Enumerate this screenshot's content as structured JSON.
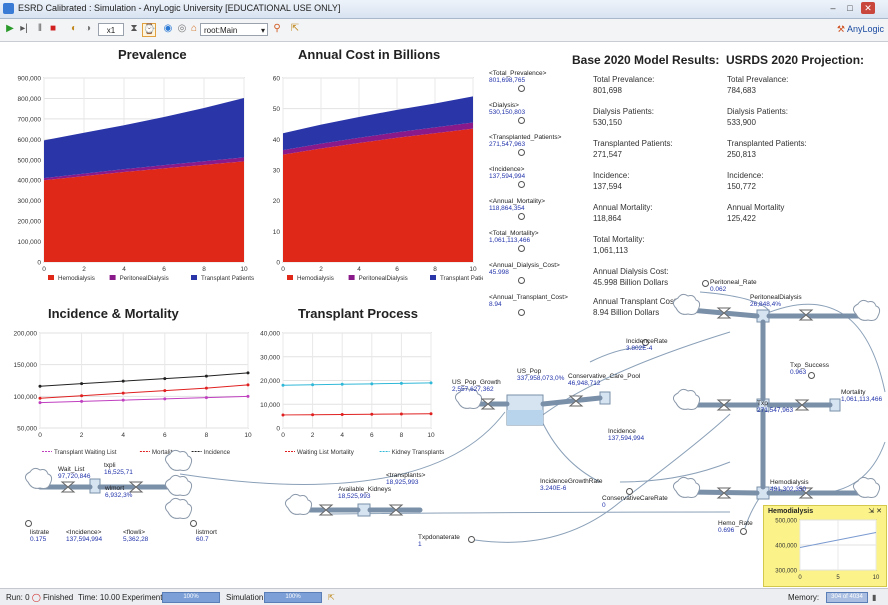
{
  "window": {
    "title": "ESRD Calibrated : Simulation - AnyLogic University  [EDUCATIONAL USE ONLY]",
    "brand": "AnyLogic"
  },
  "toolbar": {
    "speed": "x1",
    "view_select": "root:Main"
  },
  "charts": {
    "prevalence_title": "Prevalence",
    "cost_title": "Annual Cost in Billions",
    "incidence_title": "Incidence & Mortality",
    "transplant_title": "Transplant Process"
  },
  "chart_data": [
    {
      "type": "area",
      "title": "Prevalence",
      "x": [
        0,
        2,
        4,
        6,
        8,
        10
      ],
      "xlim": [
        0,
        10
      ],
      "ylim": [
        0,
        900000
      ],
      "yticks": [
        "900,000",
        "800,000",
        "700,000",
        "600,000",
        "500,000",
        "400,000",
        "300,000",
        "200,000",
        "100,000",
        "0"
      ],
      "stacked": true,
      "series": [
        {
          "name": "Hemodialysis",
          "color": "#e02818",
          "values": [
            400000,
            420000,
            440000,
            458000,
            475000,
            492000
          ]
        },
        {
          "name": "PeritonealDialysis",
          "color": "#8a1a8a",
          "values": [
            10000,
            12000,
            14000,
            16000,
            18000,
            20000
          ]
        },
        {
          "name": "Transplant Patients",
          "color": "#2a35a8",
          "values": [
            185000,
            200000,
            215000,
            235000,
            260000,
            290000
          ]
        }
      ],
      "legend": "bottom"
    },
    {
      "type": "area",
      "title": "Annual Cost in Billions",
      "x": [
        0,
        2,
        4,
        6,
        8,
        10
      ],
      "xlim": [
        0,
        10
      ],
      "ylim": [
        0,
        60
      ],
      "yticks": [
        "60",
        "50",
        "40",
        "30",
        "20",
        "10",
        "0"
      ],
      "stacked": true,
      "series": [
        {
          "name": "Hemodialysis",
          "color": "#e02818",
          "values": [
            35,
            37,
            38.8,
            40.5,
            42,
            43.5
          ]
        },
        {
          "name": "PeritonealDialysis",
          "color": "#8a1a8a",
          "values": [
            1.5,
            1.6,
            1.7,
            1.8,
            1.9,
            2.0
          ]
        },
        {
          "name": "Transplant Patients",
          "color": "#2a35a8",
          "values": [
            5.5,
            6.2,
            6.8,
            7.3,
            7.8,
            8.5
          ]
        }
      ],
      "legend": "bottom"
    },
    {
      "type": "line",
      "title": "Incidence & Mortality",
      "x": [
        0,
        2,
        4,
        6,
        8,
        10
      ],
      "xlim": [
        0,
        10
      ],
      "ylim": [
        50000,
        200000
      ],
      "yticks": [
        "200,000",
        "150,000",
        "100,000",
        "50,000"
      ],
      "series": [
        {
          "name": "Transplant Waiting List",
          "color": "#c040c0",
          "values": [
            90000,
            92000,
            94000,
            96000,
            98000,
            100000
          ]
        },
        {
          "name": "Mortality",
          "color": "#e02020",
          "values": [
            97000,
            101000,
            105000,
            109000,
            113000,
            118000
          ]
        },
        {
          "name": "Incidence",
          "color": "#222222",
          "values": [
            116000,
            120000,
            124000,
            128000,
            132000,
            137000
          ]
        }
      ],
      "legend": "bottom"
    },
    {
      "type": "line",
      "title": "Transplant Process",
      "x": [
        0,
        2,
        4,
        6,
        8,
        10
      ],
      "xlim": [
        0,
        10
      ],
      "ylim": [
        0,
        40000
      ],
      "yticks": [
        "40,000",
        "30,000",
        "20,000",
        "10,000",
        "0"
      ],
      "series": [
        {
          "name": "Waiting List Mortality",
          "color": "#e02020",
          "values": [
            5500,
            5600,
            5700,
            5800,
            5900,
            6000
          ]
        },
        {
          "name": "Kidney Transplants",
          "color": "#30b8d8",
          "values": [
            18000,
            18200,
            18400,
            18600,
            18800,
            19000
          ]
        }
      ],
      "legend": "bottom"
    },
    {
      "type": "line",
      "title": "Hemodialysis",
      "x": [
        0,
        5,
        10
      ],
      "xlim": [
        0,
        10
      ],
      "ylim": [
        300000,
        500000
      ],
      "yticks": [
        "500,000",
        "400,000",
        "300,000"
      ],
      "series": [
        {
          "name": "",
          "color": "#7a9ad0",
          "values": [
            390000,
            420000,
            450000
          ]
        }
      ]
    }
  ],
  "variables": [
    {
      "name": "<Total_Prevalence>",
      "value": "801,698,765"
    },
    {
      "name": "<Dialysis>",
      "value": "530,150,803"
    },
    {
      "name": "<Transplanted_Patients>",
      "value": "271,547,963"
    },
    {
      "name": "<Incidence>",
      "value": "137,594,994"
    },
    {
      "name": "<Annual_Mortality>",
      "value": "118,864,354"
    },
    {
      "name": "<Total_Mortality>",
      "value": "1,061,113,466"
    },
    {
      "name": "<Annual_Dialysis_Cost>",
      "value": "45.998"
    },
    {
      "name": "<Annual_Transplant_Cost>",
      "value": "8.94"
    }
  ],
  "base_results": {
    "header": "Base 2020 Model Results:",
    "items": [
      {
        "label": "Total Prevalance:",
        "value": "801,698"
      },
      {
        "label": "Dialysis Patients:",
        "value": "530,150"
      },
      {
        "label": "Transplanted Patients:",
        "value": "271,547"
      },
      {
        "label": "Incidence:",
        "value": "137,594"
      },
      {
        "label": "Annual Mortality:",
        "value": "118,864"
      },
      {
        "label": "Total Mortality:",
        "value": "1,061,113"
      },
      {
        "label": "Annual Dialysis Cost:",
        "value": "45.998 Billion Dollars"
      },
      {
        "label": "Annual Transplant Cost:",
        "value": "8.94 Billion Dollars"
      }
    ]
  },
  "usrds": {
    "header": "USRDS 2020 Projection:",
    "items": [
      {
        "label": "Total Prevalance:",
        "value": "784,683"
      },
      {
        "label": "Dialysis Patients:",
        "value": "533,900"
      },
      {
        "label": "Transplanted Patients:",
        "value": "250,813"
      },
      {
        "label": "Incidence:",
        "value": "150,772"
      },
      {
        "label": "Annual Mortality",
        "value": "125,422"
      }
    ]
  },
  "model": {
    "wait_list": {
      "name": "Wait_List",
      "value": "97,720,846"
    },
    "txpli": {
      "name": "txpli",
      "value": "16,525,71"
    },
    "wlmort": {
      "name": "wlmort",
      "value": "6,932,3%"
    },
    "listrate": {
      "name": "listrate",
      "value": "0.175"
    },
    "incidence_left": {
      "name": "<Incidence>",
      "value": "137,594,994"
    },
    "flowli": {
      "name": "<flowli>",
      "value": "5,362,28"
    },
    "listmort": {
      "name": "listmort",
      "value": "60.7"
    },
    "available_kidneys": {
      "name": "Available_Kidneys",
      "value": "18,525,993"
    },
    "transplants": {
      "name": "<transplants>",
      "value": "18,925,993"
    },
    "us_pop_growth": {
      "name": "US_Pop_Growth",
      "value": "2,557,627,362"
    },
    "us_pop": {
      "name": "US_Pop",
      "value": "337,958,073,0%"
    },
    "conservative_care_pool": {
      "name": "Conservative_Care_Pool",
      "value": "46,948,712"
    },
    "incidence_rate": {
      "name": "IncidenceRate",
      "value": "3.802E-4"
    },
    "incidence_mid": {
      "name": "Incidence",
      "value": "137,594,994"
    },
    "incidence_growth_rate": {
      "name": "IncidenceGrowthRate",
      "value": "3.240E-6"
    },
    "conservative_care_rate": {
      "name": "ConservativeCareRate",
      "value": "0"
    },
    "txpdonaterate": {
      "name": "Txpdonaterate",
      "value": "1"
    },
    "peritoneal_rate": {
      "name": "Peritoneal_Rate",
      "value": "0.062"
    },
    "peritoneal_dialysis": {
      "name": "PeritonealDialysis",
      "value": "26,848,4%"
    },
    "txp_success": {
      "name": "Txp_Success",
      "value": "0.963"
    },
    "txp": {
      "name": "Txp",
      "value": "271,547,963"
    },
    "mortality": {
      "name": "Mortality",
      "value": "1,061,113,466"
    },
    "hemodialysis": {
      "name": "Hemodialysis",
      "value": "491,302,350"
    },
    "hemo_rate": {
      "name": "Hemo_Rate",
      "value": "0.696"
    }
  },
  "hemo_panel": {
    "title": "Hemodialysis"
  },
  "status": {
    "run": "Run: 0",
    "state": "Finished",
    "time": "Time: 10.00",
    "experiment_label": "Experiment:",
    "experiment_value": "100%",
    "simulation_label": "Simulation:",
    "simulation_value": "100%",
    "memory_label": "Memory:",
    "memory_value": "304 of 4034"
  }
}
